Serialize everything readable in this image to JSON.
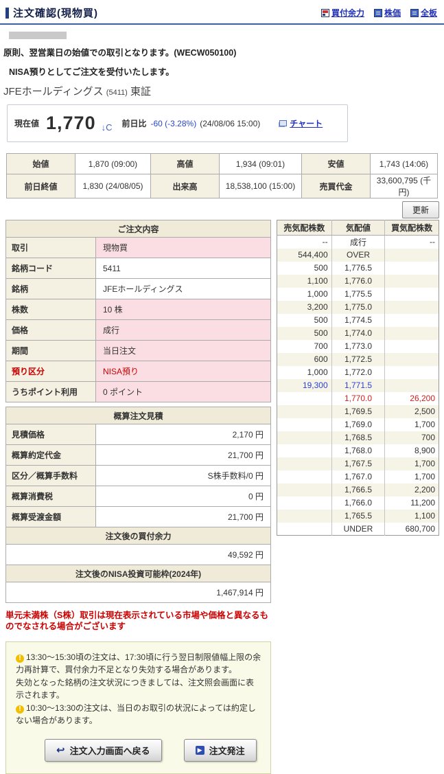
{
  "page": {
    "title": "注文確認(現物買)",
    "header_links": [
      {
        "label": "買付余力",
        "name": "buying-power"
      },
      {
        "label": "株価",
        "name": "stock-price"
      },
      {
        "label": "全板",
        "name": "full-board"
      }
    ],
    "notices": [
      "原則、翌営業日の始値での取引となります。(WECW050100)",
      "NISA預りとしてご注文を受付いたします。"
    ]
  },
  "stock": {
    "name": "JFEホールディングス",
    "code": "(5411)",
    "market": "東証"
  },
  "quote": {
    "label": "現在値",
    "price": "1,770",
    "tick": "↓C",
    "change_label": "前日比",
    "change": "-60 (-3.28%)",
    "change_time": "(24/08/06 15:00)",
    "chart_link": "チャート"
  },
  "market_table": {
    "rows": [
      [
        {
          "label": "始値",
          "value": "1,870 (09:00)"
        },
        {
          "label": "高値",
          "value": "1,934 (09:01)"
        },
        {
          "label": "安値",
          "value": "1,743 (14:06)"
        }
      ],
      [
        {
          "label": "前日終値",
          "value": "1,830 (24/08/05)"
        },
        {
          "label": "出来高",
          "value": "18,538,100 (15:00)"
        },
        {
          "label": "売買代金",
          "value": "33,600,795 (千円)"
        }
      ]
    ]
  },
  "refresh_button": "更新",
  "order_details": {
    "title": "ご注文内容",
    "rows": [
      {
        "label": "取引",
        "value": "現物買",
        "highlight": true,
        "red": false
      },
      {
        "label": "銘柄コード",
        "value": "5411",
        "highlight": false,
        "red": false
      },
      {
        "label": "銘柄",
        "value": "JFEホールディングス",
        "highlight": false,
        "red": false
      },
      {
        "label": "株数",
        "value": "10 株",
        "highlight": true,
        "red": false
      },
      {
        "label": "価格",
        "value": "成行",
        "highlight": true,
        "red": false
      },
      {
        "label": "期間",
        "value": "当日注文",
        "highlight": true,
        "red": false
      },
      {
        "label": "預り区分",
        "value": "NISA預り",
        "highlight": true,
        "red": true
      },
      {
        "label": "うちポイント利用",
        "value": "0 ポイント",
        "highlight": true,
        "red": false
      }
    ]
  },
  "estimate": {
    "title": "概算注文見積",
    "rows": [
      {
        "label": "見積価格",
        "value": "2,170 円"
      },
      {
        "label": "概算約定代金",
        "value": "21,700 円"
      },
      {
        "label": "区分／概算手数料",
        "value": "S株手数料/0 円"
      },
      {
        "label": "概算消費税",
        "value": "0 円"
      },
      {
        "label": "概算受渡金額",
        "value": "21,700 円"
      }
    ],
    "sections": [
      {
        "header": "注文後の買付余力",
        "value": "49,592 円"
      },
      {
        "header": "注文後のNISA投資可能枠(2024年)",
        "value": "1,467,914 円"
      }
    ]
  },
  "order_book": {
    "headers": [
      "売気配株数",
      "気配値",
      "買気配株数"
    ],
    "rows": [
      {
        "sell": "--",
        "price": "成行",
        "buy": "--",
        "color": ""
      },
      {
        "sell": "544,400",
        "price": "OVER",
        "buy": "",
        "color": ""
      },
      {
        "sell": "500",
        "price": "1,776.5",
        "buy": "",
        "color": ""
      },
      {
        "sell": "1,100",
        "price": "1,776.0",
        "buy": "",
        "color": ""
      },
      {
        "sell": "1,000",
        "price": "1,775.5",
        "buy": "",
        "color": ""
      },
      {
        "sell": "3,200",
        "price": "1,775.0",
        "buy": "",
        "color": ""
      },
      {
        "sell": "500",
        "price": "1,774.5",
        "buy": "",
        "color": ""
      },
      {
        "sell": "500",
        "price": "1,774.0",
        "buy": "",
        "color": ""
      },
      {
        "sell": "700",
        "price": "1,773.0",
        "buy": "",
        "color": ""
      },
      {
        "sell": "600",
        "price": "1,772.5",
        "buy": "",
        "color": ""
      },
      {
        "sell": "1,000",
        "price": "1,772.0",
        "buy": "",
        "color": ""
      },
      {
        "sell": "19,300",
        "price": "1,771.5",
        "buy": "",
        "color": "blue"
      },
      {
        "sell": "",
        "price": "1,770.0",
        "buy": "26,200",
        "color": "red"
      },
      {
        "sell": "",
        "price": "1,769.5",
        "buy": "2,500",
        "color": ""
      },
      {
        "sell": "",
        "price": "1,769.0",
        "buy": "1,700",
        "color": ""
      },
      {
        "sell": "",
        "price": "1,768.5",
        "buy": "700",
        "color": ""
      },
      {
        "sell": "",
        "price": "1,768.0",
        "buy": "8,900",
        "color": ""
      },
      {
        "sell": "",
        "price": "1,767.5",
        "buy": "1,700",
        "color": ""
      },
      {
        "sell": "",
        "price": "1,767.0",
        "buy": "1,700",
        "color": ""
      },
      {
        "sell": "",
        "price": "1,766.5",
        "buy": "2,200",
        "color": ""
      },
      {
        "sell": "",
        "price": "1,766.0",
        "buy": "11,200",
        "color": ""
      },
      {
        "sell": "",
        "price": "1,765.5",
        "buy": "1,100",
        "color": ""
      },
      {
        "sell": "",
        "price": "UNDER",
        "buy": "680,700",
        "color": ""
      }
    ]
  },
  "warning_text": "単元未満株（S株）取引は現在表示されている市場や価格と異なるものでなされる場合がございます",
  "notice_box": {
    "lines": [
      {
        "icon": true,
        "text": "13:30～15:30頃の注文は、17:30頃に行う翌日制限値幅上限の余力再計算で、買付余力不足となり失効する場合があります。"
      },
      {
        "icon": false,
        "text": "失効となった銘柄の注文状況につきましては、注文照会画面に表示されます。"
      },
      {
        "icon": true,
        "text": "10:30～13:30の注文は、当日のお取引の状況によっては約定しない場合があります。"
      }
    ],
    "back_button": "注文入力画面へ戻る",
    "submit_button": "注文発注"
  },
  "colors": {
    "accent_navy": "#24407E",
    "link_blue": "#2030BB",
    "down_blue": "#2B3FD6",
    "alert_red": "#CC0000",
    "highlight_pink": "#FBDEE4",
    "label_beige": "#F5F1E2",
    "notice_bg": "#FAFAE8"
  }
}
